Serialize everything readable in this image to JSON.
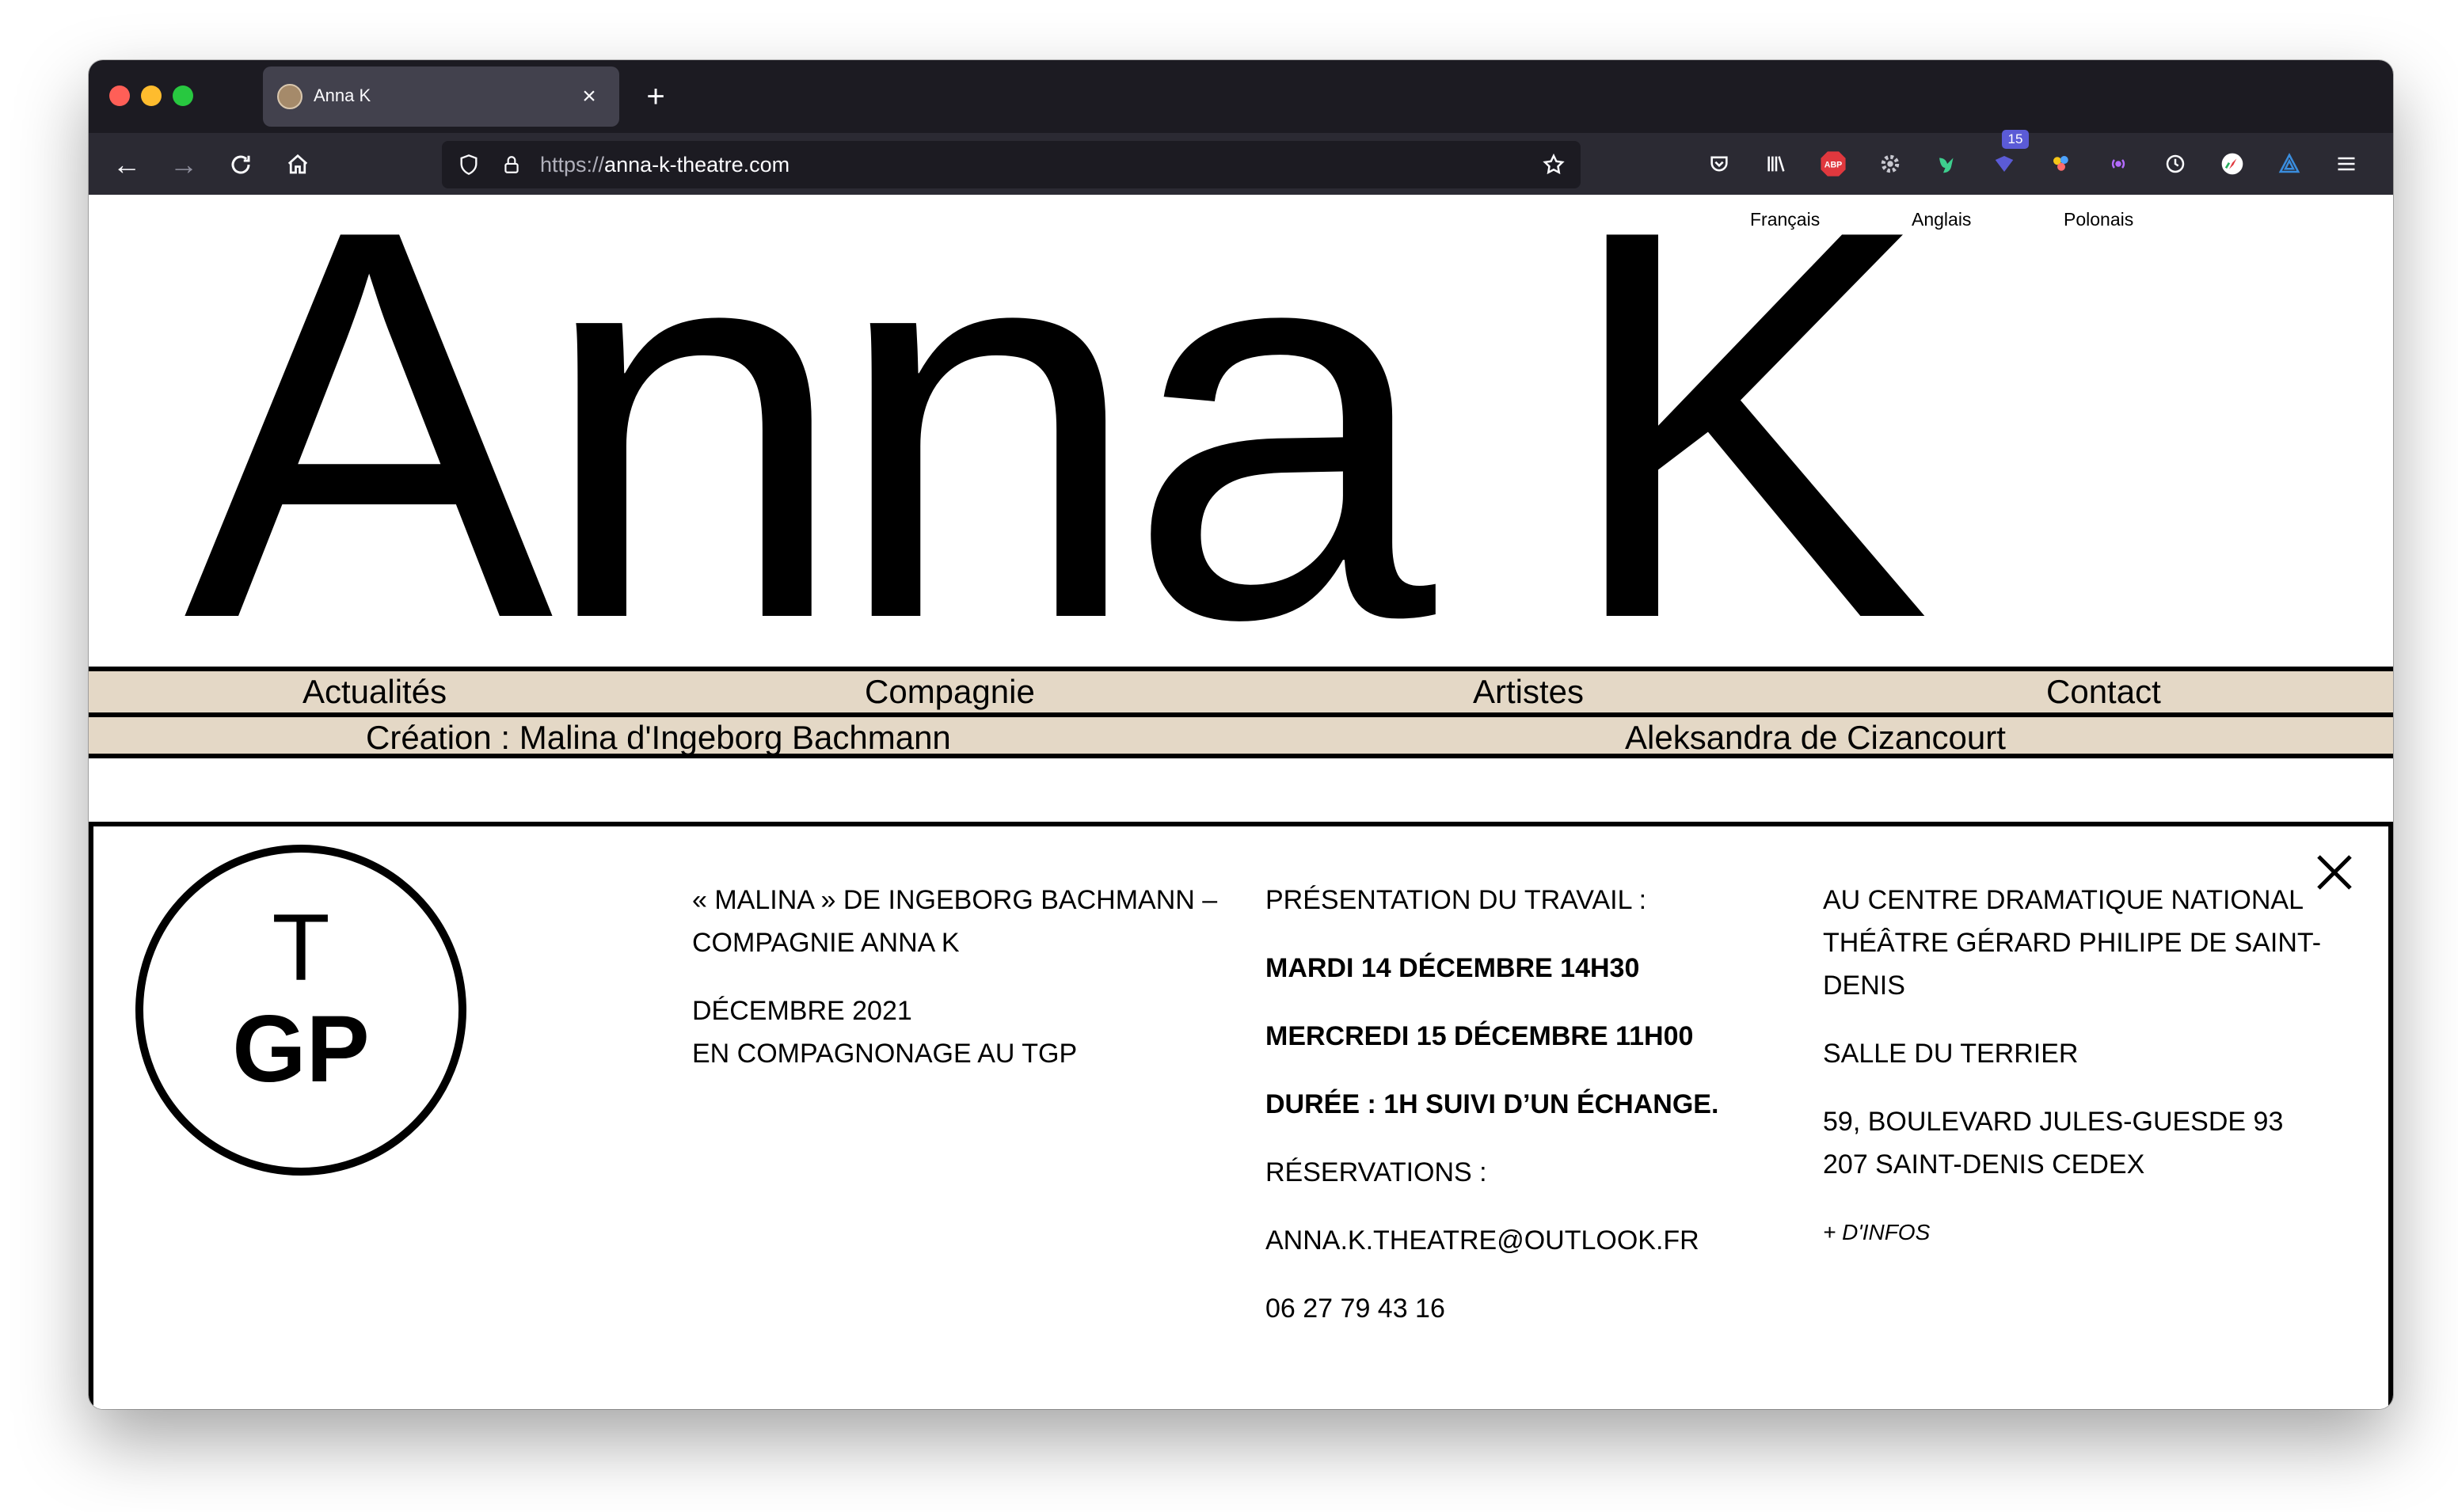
{
  "browser": {
    "tab_title": "Anna K",
    "tab_close": "×",
    "new_tab": "+",
    "url_scheme": "https://",
    "url_host": "anna-k-theatre.com",
    "ext_badge_count": "15"
  },
  "header": {
    "title": "Anna K",
    "languages": [
      "Français",
      "Anglais",
      "Polonais"
    ]
  },
  "menu": {
    "row1": [
      "Actualités",
      "Compagnie",
      "Artistes",
      "Contact"
    ],
    "row2": [
      "Création : Malina d'Ingeborg Bachmann",
      "Aleksandra de Cizancourt"
    ]
  },
  "panel": {
    "logo_top": "T",
    "logo_bottom": "GP",
    "col1": {
      "line1": "« MALINA » DE INGEBORG BACHMANN –",
      "line2": "COMPAGNIE ANNA K",
      "line3": "DÉCEMBRE 2021",
      "line4": "EN COMPAGNONAGE AU TGP"
    },
    "col2": {
      "heading": "PRÉSENTATION DU TRAVAIL :",
      "date1": "MARDI 14 DÉCEMBRE 14H30",
      "date2": "MERCREDI 15 DÉCEMBRE 11H00",
      "duration": "DURÉE : 1H SUIVI D’UN ÉCHANGE.",
      "reservations": "RÉSERVATIONS :",
      "email": "ANNA.K.THEATRE@OUTLOOK.FR",
      "phone": "06 27 79 43 16"
    },
    "col3": {
      "venue_line1": "AU CENTRE DRAMATIQUE NATIONAL",
      "venue_line2": "THÉÂTRE GÉRARD PHILIPE DE SAINT-",
      "venue_line3": "DENIS",
      "room": "SALLE DU TERRIER",
      "address_line1": "59, BOULEVARD JULES-GUESDE 93",
      "address_line2": "207 SAINT-DENIS CEDEX",
      "more_info": "+ D'INFOS"
    }
  },
  "colors": {
    "menu_background": "#e4d8c6",
    "chrome_dark": "#1c1b22",
    "chrome_toolbar": "#2b2a33"
  }
}
